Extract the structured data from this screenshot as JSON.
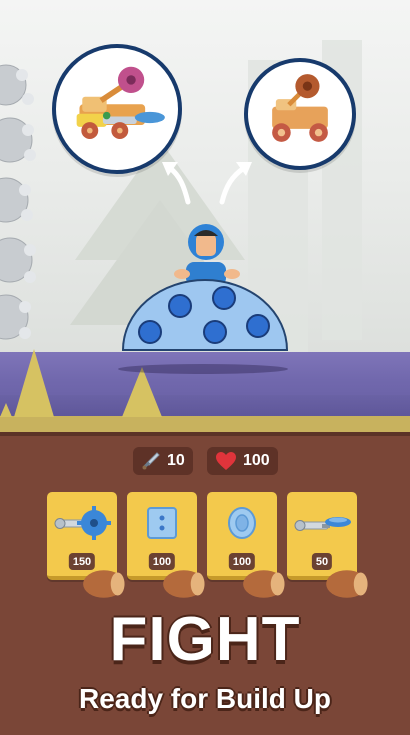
{
  "stats": {
    "attack_value": "10",
    "health_value": "100"
  },
  "shop": {
    "items": [
      {
        "name": "gear-mace-part",
        "price": "150"
      },
      {
        "name": "ice-block-part",
        "price": "100"
      },
      {
        "name": "wheel-part",
        "price": "100"
      },
      {
        "name": "saucer-cannon-part",
        "price": "50"
      }
    ]
  },
  "banner": {
    "title": "FIGHT",
    "subtitle": "Ready for Build Up"
  },
  "colors": {
    "panel": "#7a4637",
    "card": "#f3c94c",
    "floor": "#7168ad",
    "bubble_border": "#173a6c",
    "dome": "#9ec7f0",
    "dome_hole": "#2f6fd0"
  }
}
